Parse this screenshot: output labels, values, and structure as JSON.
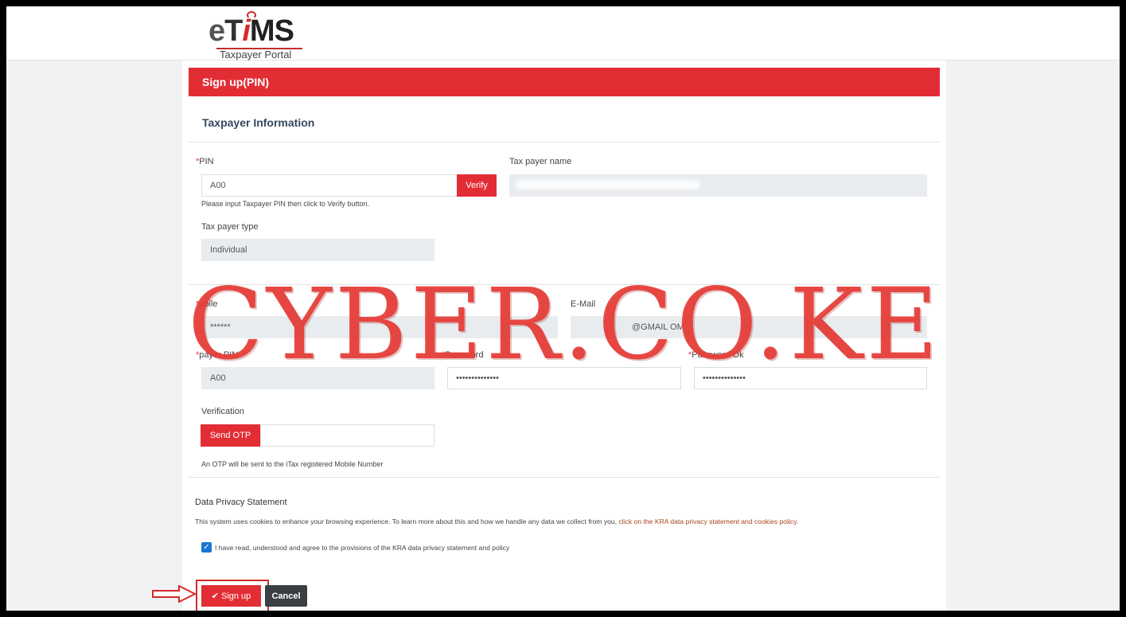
{
  "header": {
    "logo_text_e": "e",
    "logo_text_t": "T",
    "logo_text_i": "i",
    "logo_text_ms": "MS",
    "logo_subtitle": "Taxpayer Portal"
  },
  "page": {
    "title": "Sign up(PIN)",
    "section_title": "Taxpayer Information"
  },
  "form": {
    "pin_label": "PIN",
    "pin_value": "A00",
    "verify_button": "Verify",
    "pin_help": "Please input Taxpayer PIN then click to Verify button.",
    "taxpayer_name_label": "Tax payer name",
    "taxpayer_type_label": "Tax payer type",
    "taxpayer_type_value": "Individual",
    "mobile_label": "obile",
    "mobile_value": "******",
    "email_label": "E-Mail",
    "email_value": "@GMAIL   OM",
    "agent_pin_label": "payer PIN",
    "agent_pin_value": "A00",
    "password_label": "Password",
    "password_value": "••••••••••••••",
    "password_ok_label": "Password Ok",
    "password_ok_value": "••••••••••••••",
    "verification_label": "Verification",
    "send_otp_button": "Send OTP",
    "otp_help": "An OTP will be sent to the iTax registered Mobile Number"
  },
  "privacy": {
    "title": "Data Privacy Statement",
    "text": "This system uses cookies to enhance your browsing experience. To learn more about this and how we handle any data we collect from you, ",
    "link": "click on the KRA data privacy statement and cookies policy.",
    "agree_label": "I have read, understood and agree to the provisions of the KRA data privacy statement and policy",
    "agree_checked": true
  },
  "actions": {
    "signup_button": "Sign up",
    "cancel_button": "Cancel"
  },
  "watermark": "CYBER.CO.KE",
  "colors": {
    "brand_red": "#e32d35",
    "dark_button": "#3a3f44",
    "readonly_bg": "#e9ecef"
  }
}
